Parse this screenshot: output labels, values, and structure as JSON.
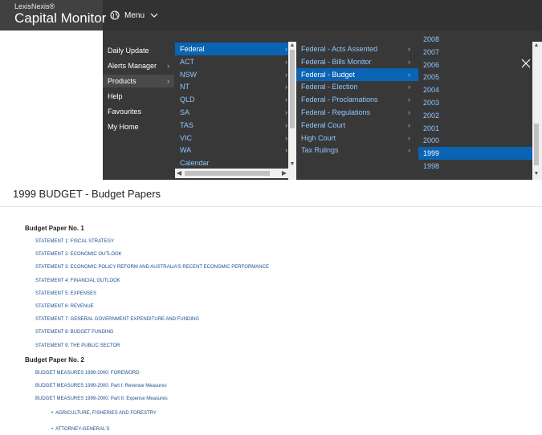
{
  "header": {
    "brand": "LexisNexis®",
    "product": "Capital Monitor",
    "menu_label": "Menu",
    "globe_icon": "globe-icon",
    "chevron_icon": "chevron-down-icon"
  },
  "menu": {
    "col1": [
      {
        "label": "Daily Update",
        "arrow": ""
      },
      {
        "label": "Alerts Manager",
        "arrow": "›"
      },
      {
        "label": "Products",
        "arrow": "›"
      },
      {
        "label": "Help",
        "arrow": ""
      },
      {
        "label": "Favourites",
        "arrow": ""
      },
      {
        "label": "My Home",
        "arrow": ""
      }
    ],
    "col2": [
      {
        "label": "Federal",
        "arrow": "›"
      },
      {
        "label": "ACT",
        "arrow": "›"
      },
      {
        "label": "NSW",
        "arrow": "›"
      },
      {
        "label": "NT",
        "arrow": "›"
      },
      {
        "label": "QLD",
        "arrow": "›"
      },
      {
        "label": "SA",
        "arrow": "›"
      },
      {
        "label": "TAS",
        "arrow": "›"
      },
      {
        "label": "VIC",
        "arrow": "›"
      },
      {
        "label": "WA",
        "arrow": "›"
      },
      {
        "label": "Calendar",
        "arrow": ""
      }
    ],
    "col3": [
      {
        "label": "Federal - Acts Assented",
        "arrow": "›"
      },
      {
        "label": "Federal - Bills Monitor",
        "arrow": "›"
      },
      {
        "label": "Federal - Budget",
        "arrow": "›"
      },
      {
        "label": "Federal - Election",
        "arrow": "›"
      },
      {
        "label": "Federal - Proclamations",
        "arrow": "›"
      },
      {
        "label": "Federal - Regulations",
        "arrow": "›"
      },
      {
        "label": "Federal Court",
        "arrow": "›"
      },
      {
        "label": "High Court",
        "arrow": "›"
      },
      {
        "label": "Tax Rulings",
        "arrow": "›"
      }
    ],
    "col4": [
      "2008",
      "2007",
      "2006",
      "2005",
      "2004",
      "2003",
      "2002",
      "2001",
      "2000",
      "1999",
      "1998"
    ],
    "selected": {
      "col1": "Products",
      "col2": "Federal",
      "col3": "Federal - Budget",
      "col4": "1999"
    },
    "close_icon": "close-icon"
  },
  "page": {
    "title": "1999 BUDGET  - Budget Papers",
    "paper1": {
      "heading": "Budget Paper No. 1",
      "links": [
        "STATEMENT 1: FISCAL STRATEGY",
        "STATEMENT 2: ECONOMIC OUTLOOK",
        "STATEMENT 3: ECONOMIC POLICY REFORM AND AUSTRALIA'S RECENT ECONOMIC PERFORMANCE",
        "STATEMENT 4: FINANCIAL OUTLOOK",
        "STATEMENT 5: EXPENSES",
        "STATEMENT 6: REVENUE",
        "STATEMENT 7: GENERAL GOVERNMENT EXPENDITURE AND FUNDING",
        "STATEMENT 8: BUDGET FUNDING",
        "STATEMENT 9: THE PUBLIC SECTOR"
      ]
    },
    "paper2": {
      "heading": "Budget Paper No. 2",
      "links": [
        "BUDGET MEASURES 1999-2000: FOREWORD",
        "BUDGET MEASURES 1999-2000: Part I: Revenue Measures",
        "BUDGET MEASURES 1999-2000: Part II: Expense Measures"
      ],
      "sublinks": [
        "AGRICULTURE, FISHERIES AND FORESTRY",
        "ATTORNEY-GENERAL'S"
      ]
    }
  },
  "colors": {
    "header_bg": "#323232",
    "menu_bg": "#383838",
    "selected_bg": "#0a64b4",
    "link_color": "#1a4f8f"
  }
}
